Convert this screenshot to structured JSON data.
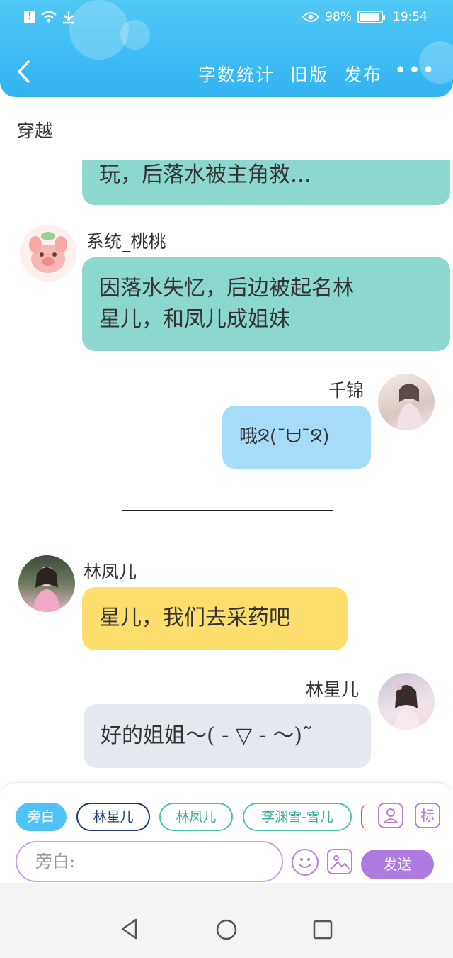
{
  "status_bar": {
    "battery": "98%",
    "battery_level": 0.98,
    "time": "19:54"
  },
  "header": {
    "actions": [
      "字数统计",
      "旧版",
      "发布"
    ],
    "more": "•••"
  },
  "story": {
    "title": "穿越"
  },
  "messages": [
    {
      "speaker": "",
      "text": "玩，后落水被主角救…",
      "color": "#8cd8ce"
    },
    {
      "speaker": "系统_桃桃",
      "lines": [
        "因落水失忆，后边被起名林",
        "星儿，和凤儿成姐妹"
      ],
      "color": "#8cd8ce"
    },
    {
      "speaker": "千锦",
      "text": "哦ᘝ(¯ᗨ¯ᘝ)",
      "color": "#a6dcfa"
    },
    {
      "speaker": "林凤儿",
      "text": "星儿，我们去采药吧",
      "color": "#fede6d"
    },
    {
      "speaker": "林星儿",
      "text": "好的姐姐～( ‐ ▽ ‐ ～)˜",
      "color": "#e4e9ef"
    }
  ],
  "roles": [
    "旁白",
    "林星儿",
    "林凤儿",
    "李渊雪-雪儿"
  ],
  "tools": {
    "tag_label": "标"
  },
  "input": {
    "placeholder": "旁白:"
  },
  "send_label": "发送",
  "colors": {
    "header": "#3bb8f3",
    "accent": "#b07be0"
  }
}
